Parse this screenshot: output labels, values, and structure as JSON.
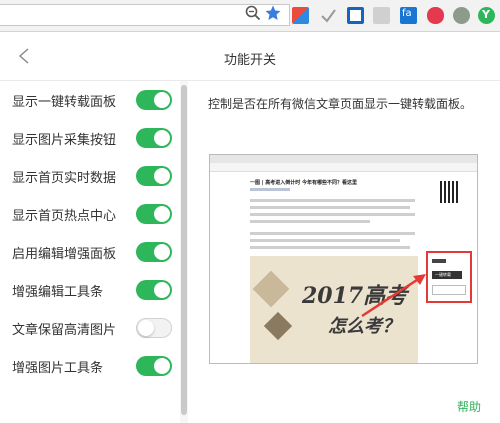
{
  "panel": {
    "title": "功能开关",
    "description": "控制是否在所有微信文章页面显示一键转载面板。",
    "help_label": "帮助"
  },
  "settings": [
    {
      "label": "显示一键转载面板",
      "enabled": true
    },
    {
      "label": "显示图片采集按钮",
      "enabled": true
    },
    {
      "label": "显示首页实时数据",
      "enabled": true
    },
    {
      "label": "显示首页热点中心",
      "enabled": true
    },
    {
      "label": "启用编辑增强面板",
      "enabled": true
    },
    {
      "label": "增强编辑工具条",
      "enabled": true
    },
    {
      "label": "文章保留高清图片",
      "enabled": false
    },
    {
      "label": "增强图片工具条",
      "enabled": true
    }
  ],
  "preview": {
    "article_title": "一图 | 高考进入倒计时 今年有哪些不同？看这里",
    "banner_text": "2017高考",
    "banner_subtext": "怎么考？",
    "panel_label": "一键转载"
  },
  "colors": {
    "accent": "#2eb65a",
    "toggle_off": "#f2f2f2",
    "highlight": "#e53935"
  }
}
